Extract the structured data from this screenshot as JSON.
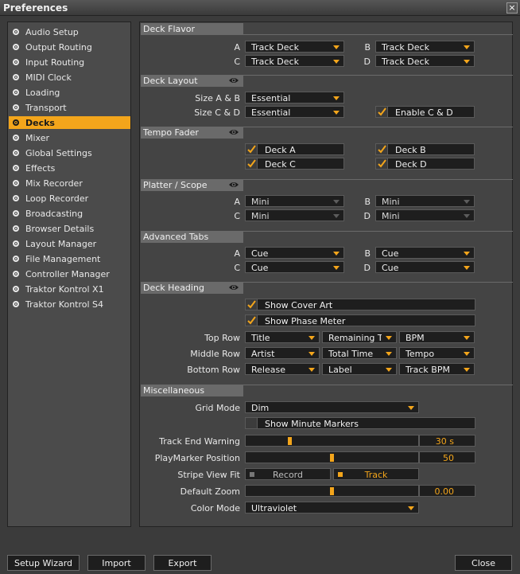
{
  "window": {
    "title": "Preferences",
    "close_glyph": "×"
  },
  "sidebar": {
    "items": [
      {
        "label": "Audio Setup"
      },
      {
        "label": "Output Routing"
      },
      {
        "label": "Input Routing"
      },
      {
        "label": "MIDI Clock"
      },
      {
        "label": "Loading"
      },
      {
        "label": "Transport"
      },
      {
        "label": "Decks"
      },
      {
        "label": "Mixer"
      },
      {
        "label": "Global Settings"
      },
      {
        "label": "Effects"
      },
      {
        "label": "Mix Recorder"
      },
      {
        "label": "Loop Recorder"
      },
      {
        "label": "Broadcasting"
      },
      {
        "label": "Browser Details"
      },
      {
        "label": "Layout Manager"
      },
      {
        "label": "File Management"
      },
      {
        "label": "Controller Manager"
      },
      {
        "label": "Traktor Kontrol X1"
      },
      {
        "label": "Traktor Kontrol S4"
      }
    ],
    "selected": "Decks"
  },
  "sections": {
    "deck_flavor": {
      "title": "Deck Flavor",
      "a_label": "A",
      "b_label": "B",
      "c_label": "C",
      "d_label": "D",
      "a": "Track Deck",
      "b": "Track Deck",
      "c": "Track Deck",
      "d": "Track Deck"
    },
    "deck_layout": {
      "title": "Deck Layout",
      "size_ab_label": "Size A & B",
      "size_ab": "Essential",
      "size_cd_label": "Size C & D",
      "size_cd": "Essential",
      "enable_cd_label": "Enable C & D",
      "enable_cd": true
    },
    "tempo_fader": {
      "title": "Tempo Fader",
      "deck_a": "Deck A",
      "deck_b": "Deck B",
      "deck_c": "Deck C",
      "deck_d": "Deck D",
      "checked": [
        true,
        true,
        true,
        true
      ]
    },
    "platter_scope": {
      "title": "Platter / Scope",
      "a_label": "A",
      "b_label": "B",
      "c_label": "C",
      "d_label": "D",
      "a": "Mini",
      "b": "Mini",
      "c": "Mini",
      "d": "Mini"
    },
    "advanced_tabs": {
      "title": "Advanced Tabs",
      "a_label": "A",
      "b_label": "B",
      "c_label": "C",
      "d_label": "D",
      "a": "Cue",
      "b": "Cue",
      "c": "Cue",
      "d": "Cue"
    },
    "deck_heading": {
      "title": "Deck Heading",
      "show_cover_art": "Show Cover Art",
      "show_cover_art_checked": true,
      "show_phase_meter": "Show Phase Meter",
      "show_phase_meter_checked": true,
      "top_row_label": "Top Row",
      "top_row": [
        "Title",
        "Remaining Time",
        "BPM"
      ],
      "middle_row_label": "Middle Row",
      "middle_row": [
        "Artist",
        "Total Time",
        "Tempo"
      ],
      "bottom_row_label": "Bottom Row",
      "bottom_row": [
        "Release",
        "Label",
        "Track BPM"
      ]
    },
    "misc": {
      "title": "Miscellaneous",
      "grid_mode_label": "Grid Mode",
      "grid_mode": "Dim",
      "show_minute_markers": "Show Minute Markers",
      "show_minute_markers_checked": false,
      "track_end_warning_label": "Track End Warning",
      "track_end_warning_value": "30 s",
      "track_end_warning_fraction": 0.25,
      "playmarker_label": "PlayMarker Position",
      "playmarker_value": "50",
      "playmarker_fraction": 0.5,
      "stripe_view_fit_label": "Stripe View Fit",
      "stripe_options": [
        "Record",
        "Track"
      ],
      "stripe_selected": "Track",
      "default_zoom_label": "Default Zoom",
      "default_zoom_value": "0.00",
      "default_zoom_fraction": 0.5,
      "color_mode_label": "Color Mode",
      "color_mode": "Ultraviolet"
    }
  },
  "footer": {
    "setup_wizard": "Setup Wizard",
    "import": "Import",
    "export": "Export",
    "close": "Close"
  },
  "colors": {
    "accent": "#f3a51b",
    "background": "#3b3b3b",
    "field": "#1e1e1e"
  },
  "icons": {
    "visibility": "eye-icon",
    "checkbox": "check-icon",
    "dropdown": "chevron-down-icon"
  }
}
